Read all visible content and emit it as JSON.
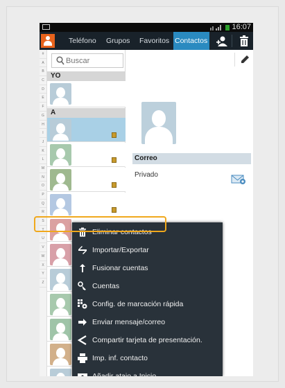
{
  "status_bar": {
    "time": "16:07"
  },
  "tabs": [
    {
      "label": "Teléfono",
      "active": false
    },
    {
      "label": "Grupos",
      "active": false
    },
    {
      "label": "Favoritos",
      "active": false
    },
    {
      "label": "Contactos",
      "active": true
    }
  ],
  "alphabet": [
    "#",
    "A",
    "B",
    "C",
    "D",
    "E",
    "F",
    "G",
    "H",
    "I",
    "J",
    "K",
    "L",
    "M",
    "N",
    "O",
    "P",
    "Q",
    "R",
    "S",
    "T",
    "U",
    "V",
    "W",
    "X",
    "Y",
    "Z"
  ],
  "search": {
    "placeholder": "Buscar"
  },
  "sections": {
    "me": "YO",
    "a": "A"
  },
  "detail": {
    "email_header": "Correo",
    "email_type": "Privado"
  },
  "menu": {
    "items": [
      {
        "label": "Eliminar contactos",
        "icon": "trash-icon"
      },
      {
        "label": "Importar/Exportar",
        "icon": "import-export-icon",
        "highlighted": true
      },
      {
        "label": "Fusionar cuentas",
        "icon": "merge-icon"
      },
      {
        "label": "Cuentas",
        "icon": "key-icon"
      },
      {
        "label": "Config. de marcación rápida",
        "icon": "speed-dial-icon"
      },
      {
        "label": "Enviar mensaje/correo",
        "icon": "arrow-right-icon"
      },
      {
        "label": "Compartir tarjeta de presentación.",
        "icon": "share-icon"
      },
      {
        "label": "Imp. inf. contacto",
        "icon": "print-icon"
      },
      {
        "label": "Añadir atajo a Inicio",
        "icon": "shortcut-icon"
      }
    ]
  },
  "colors": {
    "accent": "#2a8ac0",
    "highlight": "#f0a81c",
    "menu_bg": "#29323a",
    "selected_row": "#a9d0e6"
  }
}
